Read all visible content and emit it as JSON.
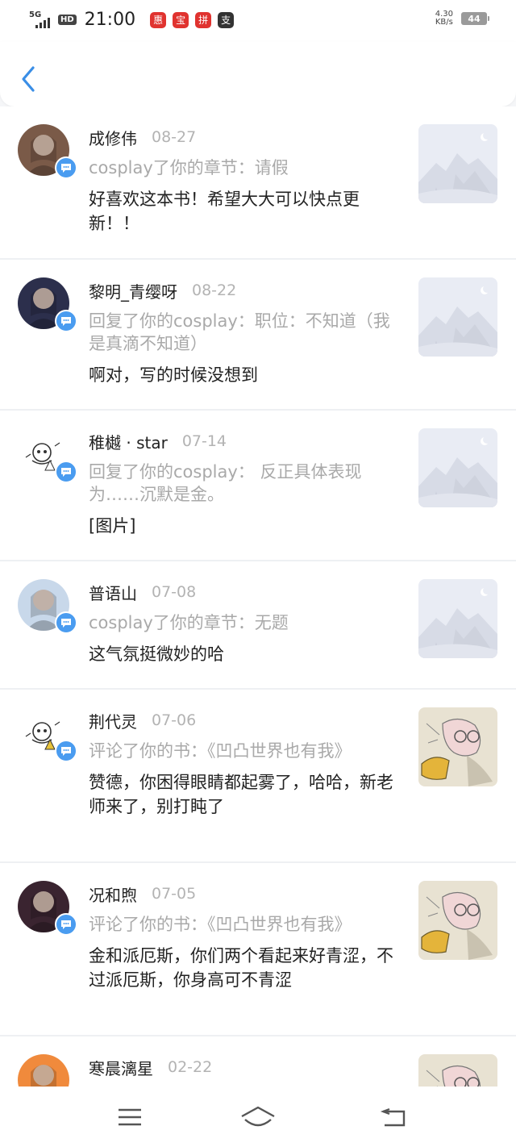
{
  "status_bar": {
    "network": "5G",
    "hd": "HD",
    "time": "21:00",
    "app_icons": [
      {
        "name": "app-notification-icon",
        "glyph": "惠",
        "color": "#e0332f"
      },
      {
        "name": "app-notification-icon",
        "glyph": "宝",
        "color": "#e0332f"
      },
      {
        "name": "app-notification-icon",
        "glyph": "拼",
        "color": "#d9262a"
      },
      {
        "name": "alipay-icon",
        "glyph": "支",
        "color": "#333333"
      }
    ],
    "speed_value": "4.30",
    "speed_unit": "KB/s",
    "battery": "44"
  },
  "header": {
    "back_icon": "chevron-left-icon",
    "accent_color": "#3a8ee6"
  },
  "messages": [
    {
      "user": "成修伟",
      "date": "08-27",
      "action": "cosplay了你的章节：请假",
      "comment": "好喜欢这本书！希望大大可以快点更新！！",
      "thumb": "mountain-placeholder",
      "avatar_color": "#7a5a48",
      "height": 188
    },
    {
      "user": "黎明_青缨呀",
      "date": "08-22",
      "action": "回复了你的cosplay：职位：不知道（我是真滴不知道）",
      "comment": "啊对，写的时候没想到",
      "thumb": "mountain-placeholder",
      "avatar_color": "#2c2f4c",
      "height": 185
    },
    {
      "user": "稚樾 · star",
      "date": "07-14",
      "action": "回复了你的cosplay：          反正具体表现为……沉默是金。",
      "comment": "[图片]",
      "thumb": "mountain-placeholder",
      "avatar_color": "#ffffff",
      "height": 185
    },
    {
      "user": "普语山",
      "date": "07-08",
      "action": "cosplay了你的章节：无题",
      "comment": "这气氛挺微妙的哈",
      "thumb": "mountain-placeholder",
      "avatar_color": "#c8d8ea",
      "height": 157
    },
    {
      "user": "荆代灵",
      "date": "07-06",
      "action": "评论了你的书：《凹凸世界也有我》",
      "comment": "赞德，你困得眼睛都起雾了，哈哈，新老师来了，别打盹了",
      "thumb": "sketch-illustration",
      "avatar_color": "#ffffff",
      "height": 213
    },
    {
      "user": "况和煦",
      "date": "07-05",
      "action": "评论了你的书：《凹凸世界也有我》",
      "comment": "金和派厄斯，你们两个看起来好青涩，不过派厄斯，你身高可不青涩",
      "thumb": "sketch-illustration",
      "avatar_color": "#3a2430",
      "height": 213
    },
    {
      "user": "寒晨漓星",
      "date": "02-22",
      "action": "",
      "comment": "",
      "thumb": "sketch-illustration",
      "avatar_color": "#f08a3c",
      "height": 80
    }
  ],
  "bottom_nav": {
    "menu_icon": "menu-icon",
    "home_icon": "home-icon",
    "back_icon": "back-arrow-icon"
  }
}
